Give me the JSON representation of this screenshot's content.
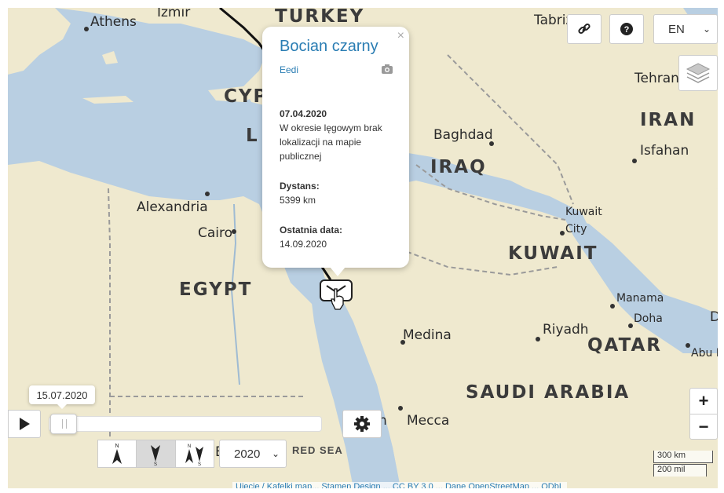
{
  "map": {
    "countries": [
      {
        "key": "turkey",
        "label": "TURKEY"
      },
      {
        "key": "cyprus",
        "label": "CYP"
      },
      {
        "key": "lebanon",
        "label": "L"
      },
      {
        "key": "iraq",
        "label": "IRAQ"
      },
      {
        "key": "iran",
        "label": "IRAN"
      },
      {
        "key": "kuwait",
        "label": "KUWAIT"
      },
      {
        "key": "egypt",
        "label": "EGYPT"
      },
      {
        "key": "qatar",
        "label": "QATAR"
      },
      {
        "key": "saudi",
        "label": "SAUDI ARABIA"
      }
    ],
    "cities": [
      {
        "key": "athens",
        "label": "Athens"
      },
      {
        "key": "izmir",
        "label": "Izmir"
      },
      {
        "key": "tabriz",
        "label": "Tabriz"
      },
      {
        "key": "tehran",
        "label": "Tehran"
      },
      {
        "key": "baghdad",
        "label": "Baghdad"
      },
      {
        "key": "isfahan",
        "label": "Isfahan"
      },
      {
        "key": "alexandria",
        "label": "Alexandria"
      },
      {
        "key": "cairo",
        "label": "Cairo"
      },
      {
        "key": "kuwait_city_1",
        "label": "Kuwait"
      },
      {
        "key": "kuwait_city_2",
        "label": "City"
      },
      {
        "key": "manama",
        "label": "Manama"
      },
      {
        "key": "doha",
        "label": "Doha"
      },
      {
        "key": "riyadh",
        "label": "Riyadh"
      },
      {
        "key": "medina",
        "label": "Medina"
      },
      {
        "key": "mecca",
        "label": "Mecca"
      },
      {
        "key": "abu",
        "label": "Abu D"
      },
      {
        "key": "d_edge",
        "label": "D"
      },
      {
        "key": "n_partial",
        "label": "n"
      },
      {
        "key": "e_partial",
        "label": "E"
      }
    ],
    "seas": [
      {
        "key": "red_sea",
        "label": "RED SEA"
      }
    ],
    "colors": {
      "water": "#b9cfe2",
      "land": "#efe9cf",
      "track": "#111111",
      "link": "#2a7db3"
    }
  },
  "toolbar": {
    "link_icon": "link-icon",
    "help_icon": "help-icon",
    "language": "EN",
    "layers_icon": "layers-icon"
  },
  "popup": {
    "title": "Bocian czarny",
    "owner": "Eedi",
    "date": "07.04.2020",
    "note": "W okresie lęgowym brak lokalizacji na mapie publicznej",
    "distance_label": "Dystans:",
    "distance_value": "5399 km",
    "last_date_label": "Ostatnia data:",
    "last_date_value": "14.09.2020",
    "close": "×"
  },
  "timeline": {
    "current_date": "15.07.2020",
    "progress": 0.02,
    "year": "2020"
  },
  "zoom": {
    "in": "+",
    "out": "−"
  },
  "scale": {
    "metric": "300 km",
    "imperial": "200 mil"
  },
  "attribution": "Ujęcie / Kafelki map... Stamen Design ... CC BY 3.0 ... Dane OpenStreetMap ... ODbL"
}
